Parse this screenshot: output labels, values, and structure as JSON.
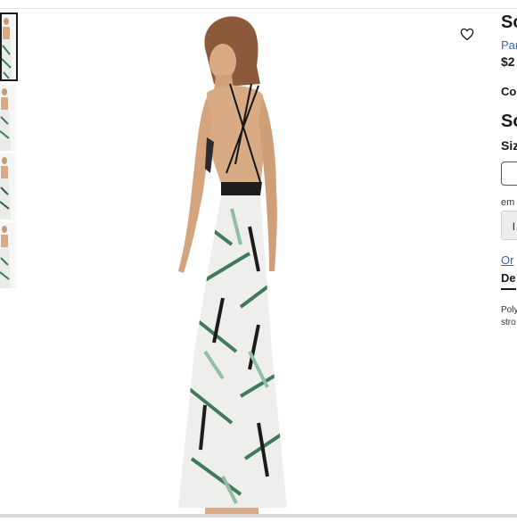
{
  "gallery": {
    "thumbnail_count": 4,
    "active_index": 0,
    "main_image_alt": "Model wearing tropical print backless maxi dress"
  },
  "product": {
    "title": "So",
    "brand": "Par",
    "price": "$2",
    "color_label": "Co",
    "color_name": "So",
    "size_label": "Siz",
    "email_label": "em",
    "notify_button": "l",
    "or_link": "Or",
    "details_tab": "De",
    "details_text": "Poly\nstro"
  },
  "icons": {
    "wishlist": "heart-outline-icon"
  },
  "colors": {
    "link": "#3867b6",
    "text": "#1a1a1a",
    "dress_black": "#1c1c1c",
    "print_green": "#3f7a5a"
  }
}
